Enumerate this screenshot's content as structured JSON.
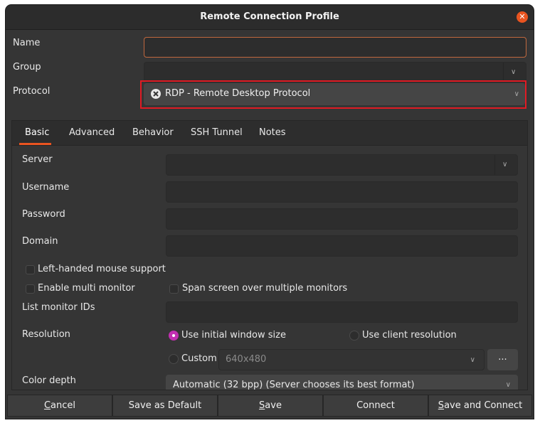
{
  "window": {
    "title": "Remote Connection Profile"
  },
  "fields": {
    "name_label": "Name",
    "name_value": "",
    "group_label": "Group",
    "group_value": "",
    "protocol_label": "Protocol",
    "protocol_value": "RDP - Remote Desktop Protocol"
  },
  "tabs": [
    {
      "label": "Basic",
      "active": true
    },
    {
      "label": "Advanced"
    },
    {
      "label": "Behavior"
    },
    {
      "label": "SSH Tunnel"
    },
    {
      "label": "Notes"
    }
  ],
  "basic": {
    "server_label": "Server",
    "username_label": "Username",
    "password_label": "Password",
    "domain_label": "Domain",
    "left_handed_label": "Left-handed mouse support",
    "multi_monitor_label": "Enable multi monitor",
    "span_screen_label": "Span screen over multiple monitors",
    "list_monitor_label": "List monitor IDs",
    "resolution_label": "Resolution",
    "res_initial_label": "Use initial window size",
    "res_client_label": "Use client resolution",
    "res_custom_label": "Custom",
    "custom_value": "640x480",
    "ellipsis_label": "...",
    "color_depth_label": "Color depth",
    "color_depth_value": "Automatic (32 bpp) (Server chooses its best format)"
  },
  "footer": {
    "cancel_letter": "C",
    "cancel_rest": "ancel",
    "save_default": "Save as Default",
    "save_letter": "S",
    "save_rest": "ave",
    "connect": "Connect",
    "save_connect_letter": "S",
    "save_connect_rest": "ave and Connect"
  },
  "colors": {
    "accent": "#e95420",
    "highlight": "#e01b24",
    "radio": "#c22fb1"
  }
}
